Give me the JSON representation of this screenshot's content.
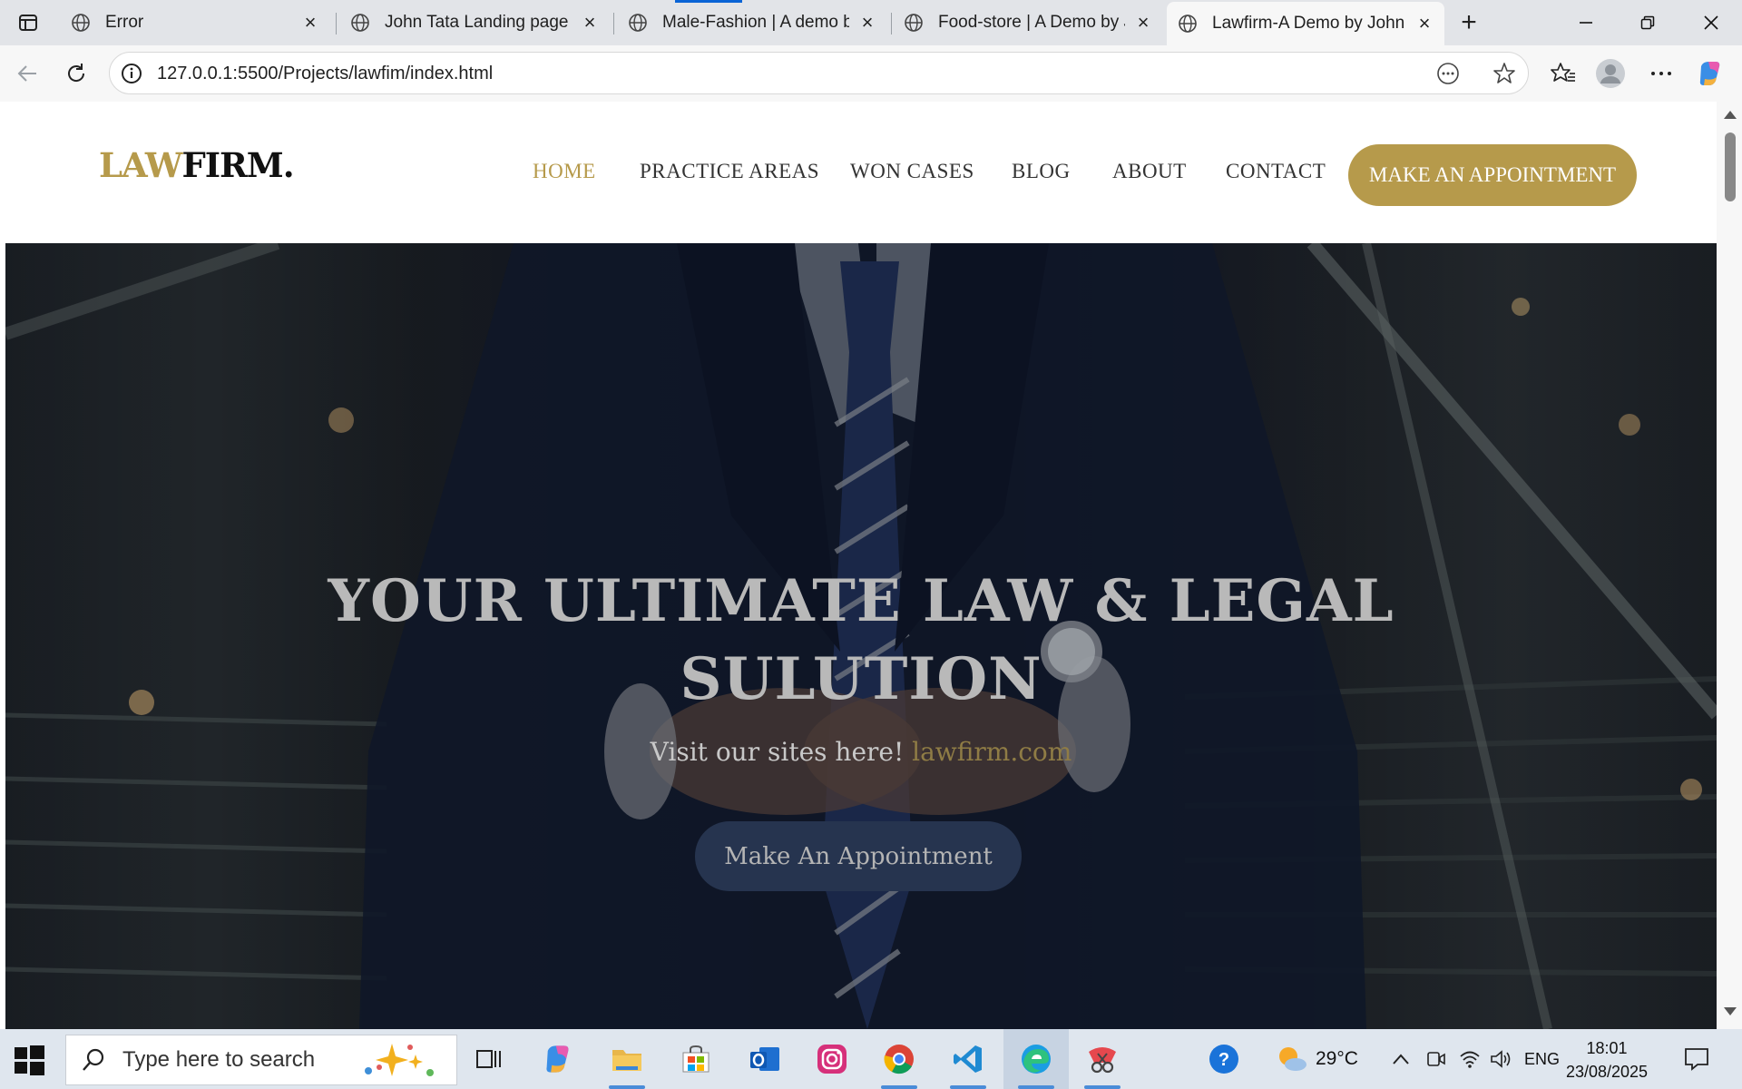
{
  "browser": {
    "tabs": [
      {
        "title": "Error",
        "active": false
      },
      {
        "title": "John Tata Landing page | F",
        "active": false
      },
      {
        "title": "Male-Fashion | A demo by",
        "active": false
      },
      {
        "title": "Food-store | A Demo by Jo",
        "active": false
      },
      {
        "title": "Lawfirm-A Demo by John T",
        "active": true
      }
    ],
    "url": "127.0.0.1:5500/Projects/lawfim/index.html"
  },
  "site": {
    "logo_part1": "LAW",
    "logo_part2": "FIRM.",
    "nav": [
      {
        "label": "HOME",
        "active": true
      },
      {
        "label": "PRACTICE AREAS"
      },
      {
        "label": "WON CASES"
      },
      {
        "label": "BLOG"
      },
      {
        "label": "ABOUT"
      },
      {
        "label": "CONTACT"
      }
    ],
    "cta_label": "MAKE AN APPOINTMENT",
    "accent_color": "#b69a4b",
    "hero": {
      "title_line1": "YOUR ULTIMATE LAW & LEGAL",
      "title_line2": "SULUTION",
      "subtitle_text": "Visit our sites here!",
      "subtitle_link": "lawfirm.com",
      "button_label": "Make An Appointment"
    }
  },
  "taskbar": {
    "search_placeholder": "Type here to search",
    "weather": "29°C",
    "language": "ENG",
    "time": "18:01",
    "date": "23/08/2025"
  }
}
